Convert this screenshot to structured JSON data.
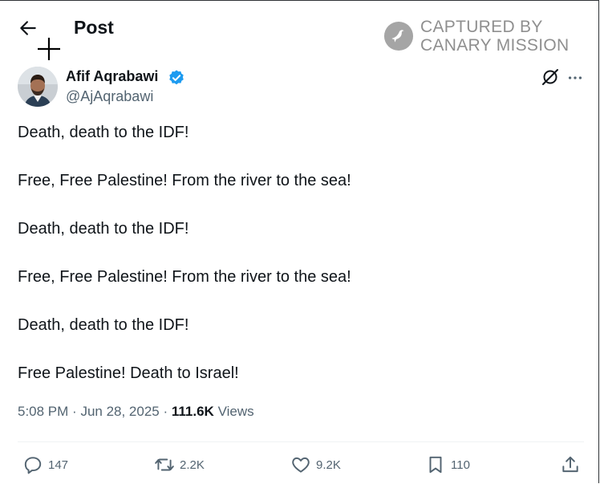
{
  "header": {
    "title": "Post"
  },
  "watermark": {
    "line1": "CAPTURED BY",
    "line2": "CANARY MISSION"
  },
  "author": {
    "name": "Afif Aqrabawi",
    "handle": "@AjAqrabawi",
    "verified_color": "#1d9bf0"
  },
  "post": {
    "lines": [
      "Death, death to the IDF!",
      "Free, Free Palestine! From the river to the sea!",
      "Death, death to the IDF!",
      "Free, Free Palestine! From the river to the sea!",
      "Death, death to the IDF!",
      "Free Palestine! Death to Israel!"
    ],
    "time": "5:08 PM",
    "date": "Jun 28, 2025",
    "views_count": "111.6K",
    "views_label": "Views"
  },
  "actions": {
    "replies": "147",
    "reposts": "2.2K",
    "likes": "9.2K",
    "bookmarks": "110"
  },
  "icons": [
    "back-arrow-icon",
    "crosshair-icon",
    "canary-logo-icon",
    "verified-badge-icon",
    "grok-icon",
    "more-icon",
    "reply-icon",
    "repost-icon",
    "like-icon",
    "bookmark-icon",
    "share-icon"
  ],
  "colors": {
    "text": "#0f1419",
    "secondary": "#536471",
    "accent": "#1d9bf0",
    "watermark": "#8f8f8f"
  }
}
